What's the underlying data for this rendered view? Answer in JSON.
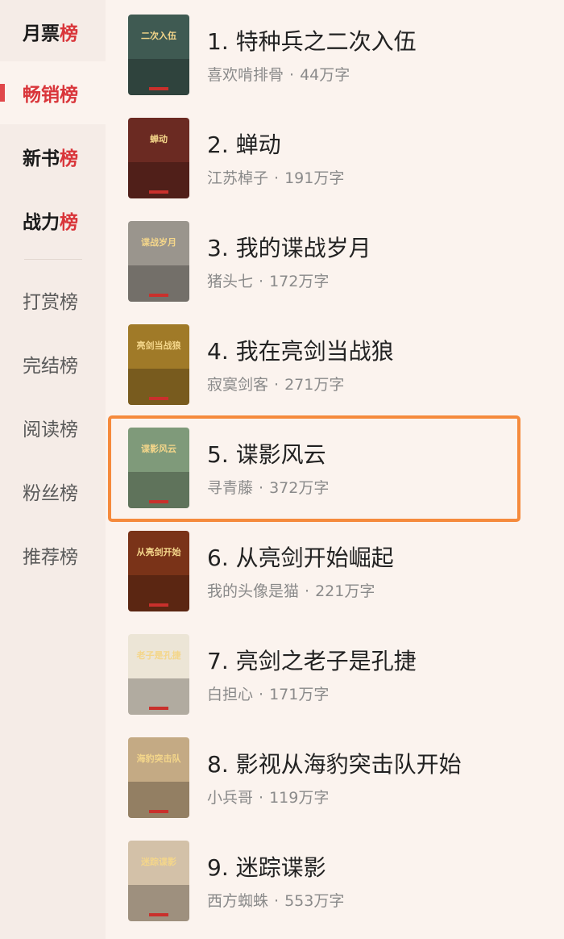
{
  "sidebar": {
    "items": [
      {
        "prefix": "月票",
        "suffix": "榜",
        "type": "main"
      },
      {
        "prefix": "畅销",
        "suffix": "榜",
        "type": "main",
        "active": true
      },
      {
        "prefix": "新书",
        "suffix": "榜",
        "type": "main"
      },
      {
        "prefix": "战力",
        "suffix": "榜",
        "type": "main"
      },
      {
        "label": "打赏榜",
        "type": "sub"
      },
      {
        "label": "完结榜",
        "type": "sub"
      },
      {
        "label": "阅读榜",
        "type": "sub"
      },
      {
        "label": "粉丝榜",
        "type": "sub"
      },
      {
        "label": "推荐榜",
        "type": "sub"
      }
    ]
  },
  "books": [
    {
      "title": "1. 特种兵之二次入伍",
      "author": "喜欢啃排骨",
      "words": "44万字",
      "cover_text": "二次入伍",
      "cover_color": "#3f5a52"
    },
    {
      "title": "2. 蝉动",
      "author": "江苏棹子",
      "words": "191万字",
      "cover_text": "蝉动",
      "cover_color": "#6b2a22"
    },
    {
      "title": "3. 我的谍战岁月",
      "author": "猪头七",
      "words": "172万字",
      "cover_text": "谍战岁月",
      "cover_color": "#9a958d"
    },
    {
      "title": "4. 我在亮剑当战狼",
      "author": "寂寞剑客",
      "words": "271万字",
      "cover_text": "亮剑当战狼",
      "cover_color": "#a07a28"
    },
    {
      "title": "5. 谍影风云",
      "author": "寻青藤",
      "words": "372万字",
      "cover_text": "谍影风云",
      "cover_color": "#7f9a7a"
    },
    {
      "title": "6. 从亮剑开始崛起",
      "author": "我的头像是猫",
      "words": "221万字",
      "cover_text": "从亮剑开始",
      "cover_color": "#7a3318"
    },
    {
      "title": "7. 亮剑之老子是孔捷",
      "author": "白担心",
      "words": "171万字",
      "cover_text": "老子是孔捷",
      "cover_color": "#ece5d6"
    },
    {
      "title": "8. 影视从海豹突击队开始",
      "author": "小兵哥",
      "words": "119万字",
      "cover_text": "海豹突击队",
      "cover_color": "#c4aa84"
    },
    {
      "title": "9. 迷踪谍影",
      "author": "西方蜘蛛",
      "words": "553万字",
      "cover_text": "迷踪谍影",
      "cover_color": "#d3c1a8"
    }
  ],
  "highlight_index": 4,
  "colors": {
    "accent": "#d9353a",
    "highlight_border": "#f58a3c"
  }
}
